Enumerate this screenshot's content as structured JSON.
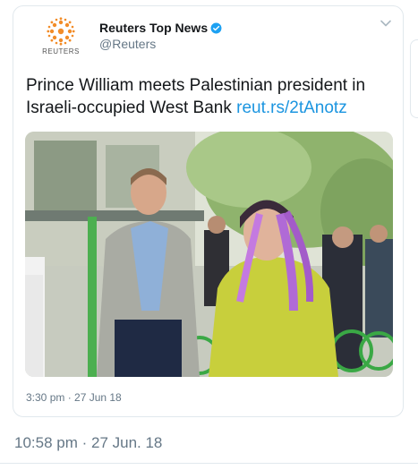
{
  "tweet": {
    "author": {
      "name": "Reuters Top News",
      "handle": "@Reuters",
      "logo_text": "REUTERS",
      "verified": true
    },
    "text": "Prince William meets Palestinian president in Israeli-occupied West Bank",
    "link": "reut.rs/2tAnotz",
    "timestamp": "3:30 pm · 27 Jun 18",
    "menu_icon": "chevron-down-icon"
  },
  "outer": {
    "timestamp": "10:58 pm · 27 Jun. 18"
  },
  "colors": {
    "link": "#1b95e0",
    "secondary_text": "#657786",
    "logo_orange": "#f28c28",
    "verified_blue": "#1da1f2",
    "border": "#e1e8ed"
  }
}
